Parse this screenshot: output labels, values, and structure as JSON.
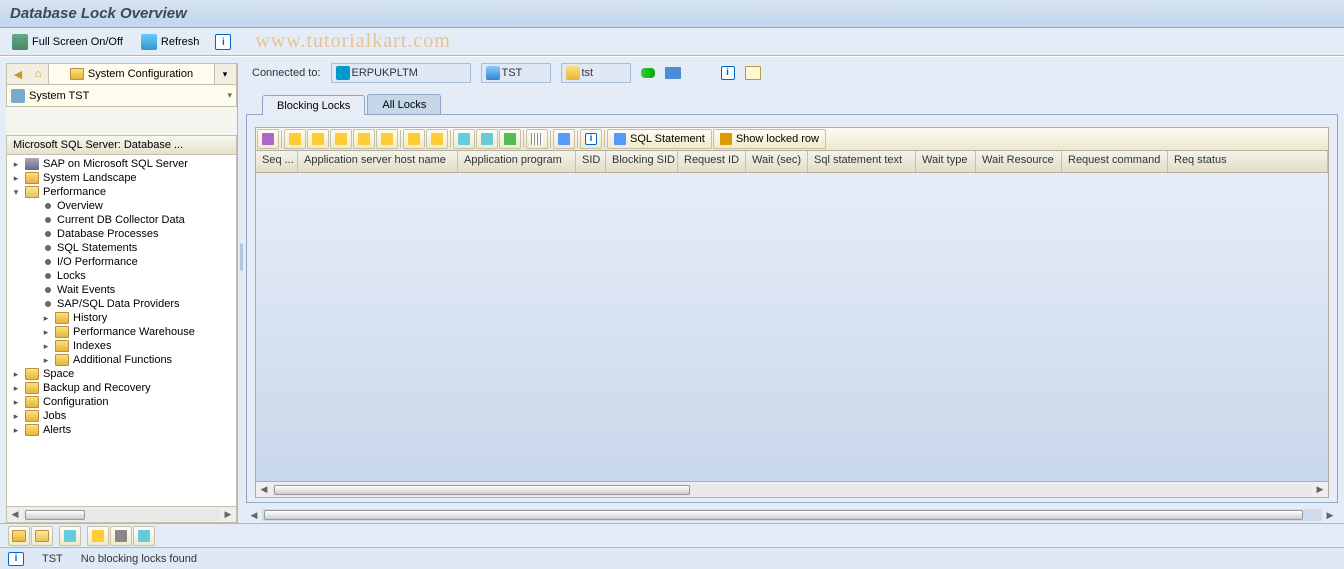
{
  "title": "Database Lock Overview",
  "watermark": "www.tutorialkart.com",
  "toolbar": {
    "fullscreen": "Full Screen On/Off",
    "refresh": "Refresh"
  },
  "sidebar": {
    "sysconfig": "System Configuration",
    "system": "System TST",
    "panel_title": "Microsoft SQL Server: Database ...",
    "tree": {
      "root1": "SAP on Microsoft SQL Server",
      "root2": "System Landscape",
      "root3": "Performance",
      "perf_children": [
        "Overview",
        "Current DB Collector Data",
        "Database Processes",
        "SQL Statements",
        "I/O Performance",
        "Locks",
        "Wait Events",
        "SAP/SQL Data Providers"
      ],
      "perf_folders": [
        "History",
        "Performance Warehouse",
        "Indexes",
        "Additional Functions"
      ],
      "roots_after": [
        "Space",
        "Backup and Recovery",
        "Configuration",
        "Jobs",
        "Alerts"
      ]
    }
  },
  "connection": {
    "label": "Connected to:",
    "host": "ERPUKPLTM",
    "sid": "TST",
    "client": "tst"
  },
  "tabs": {
    "t1": "Blocking Locks",
    "t2": "All Locks"
  },
  "grid_toolbar": {
    "sql": "SQL Statement",
    "locked": "Show locked row"
  },
  "columns": [
    "Seq ...",
    "Application server host name",
    "Application program",
    "SID",
    "Blocking SID",
    "Request ID",
    "Wait (sec)",
    "Sql statement text",
    "Wait type",
    "Wait Resource",
    "Request command",
    "Req status"
  ],
  "status": {
    "sid": "TST",
    "msg": "No blocking locks found"
  }
}
